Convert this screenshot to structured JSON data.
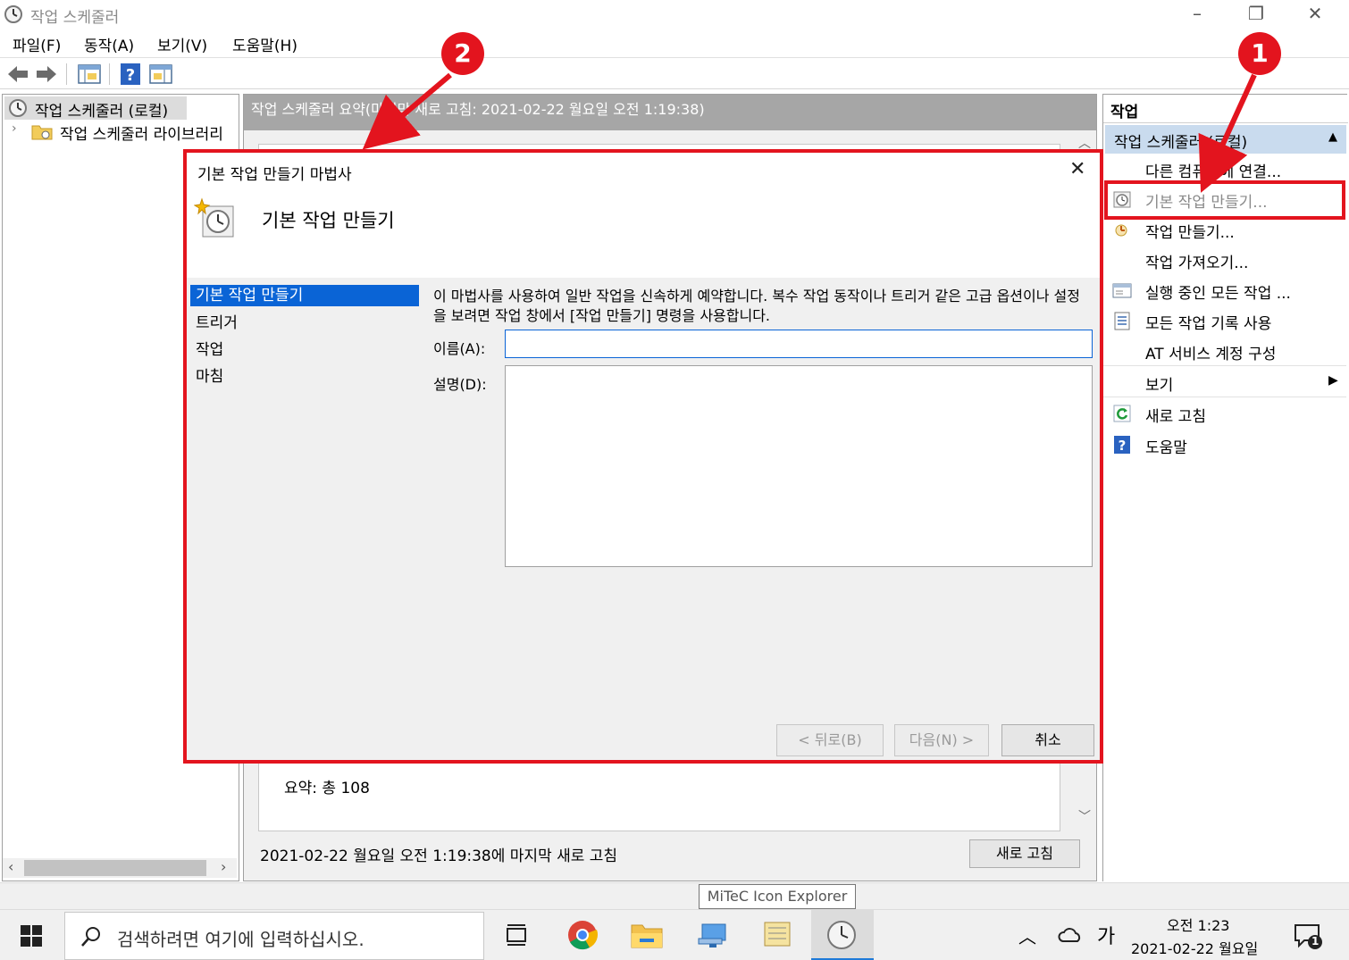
{
  "window": {
    "title": "작업 스케줄러"
  },
  "menu": [
    "파일(F)",
    "동작(A)",
    "보기(V)",
    "도움말(H)"
  ],
  "tree": {
    "root_label": "작업 스케줄러 (로컬)",
    "child_label": "작업 스케줄러 라이브러리"
  },
  "middle": {
    "header_text": "작업 스케줄러 요약(마지막 새로 고침: 2021-02-22 월요일 오전 1:19:38)",
    "summary_text": "요약: 총 108",
    "last_refresh_text": "2021-02-22 월요일 오전 1:19:38에 마지막 새로 고침",
    "refresh_button": "새로 고침"
  },
  "actions_pane": {
    "title": "작업",
    "section_title": "작업 스케줄러 (로컬)",
    "items": [
      {
        "label": "다른 컴퓨터에 연결...",
        "icon": ""
      },
      {
        "label": "기본 작업 만들기...",
        "icon": "basic-task-icon"
      },
      {
        "label": "작업 만들기...",
        "icon": "task-create-icon"
      },
      {
        "label": "작업 가져오기...",
        "icon": ""
      },
      {
        "label": "실행 중인 모든 작업 ...",
        "icon": "running-tasks-icon"
      },
      {
        "label": "모든 작업 기록 사용",
        "icon": "history-icon"
      },
      {
        "label": "AT 서비스 계정 구성",
        "icon": ""
      },
      {
        "label": "보기",
        "icon": ""
      },
      {
        "label": "새로 고침",
        "icon": "refresh-icon"
      },
      {
        "label": "도움말",
        "icon": "help-icon"
      }
    ]
  },
  "dialog": {
    "title": "기본 작업 만들기 마법사",
    "heading": "기본 작업 만들기",
    "nav": [
      "기본 작업 만들기",
      "트리거",
      "작업",
      "마침"
    ],
    "description": "이 마법사를 사용하여 일반 작업을 신속하게 예약합니다. 복수 작업 동작이나 트리거 같은 고급 옵션이나 설정을 보려면 작업 창에서 [작업 만들기] 명령을 사용합니다.",
    "name_label": "이름(A):",
    "name_value": "",
    "desc_label": "설명(D):",
    "desc_value": "",
    "back_button": "< 뒤로(B)",
    "next_button": "다음(N) >",
    "cancel_button": "취소"
  },
  "callouts": [
    "1",
    "2"
  ],
  "taskbar": {
    "search_placeholder": "검색하려면 여기에 입력하십시오.",
    "tooltip": "MiTeC Icon Explorer",
    "ime": "가",
    "time": "오전 1:23",
    "date": "2021-02-22 월요일",
    "notification_count": "1"
  },
  "colors": {
    "highlight_red": "#e3141e",
    "selection_blue": "#0a64d6",
    "section_blue": "#c9dbee"
  }
}
